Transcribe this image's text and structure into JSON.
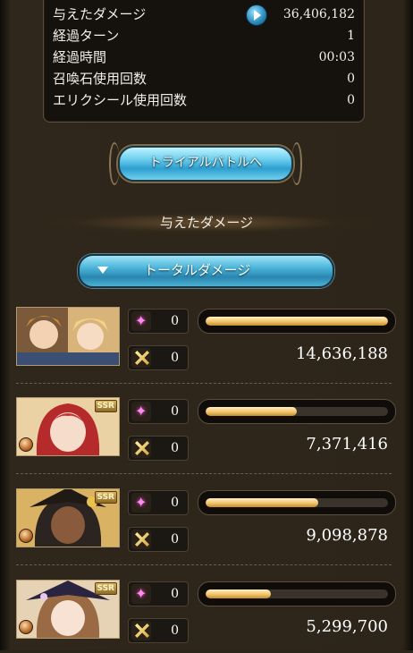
{
  "stats": {
    "rows": [
      {
        "label": "与えたダメージ",
        "value": "36,406,182"
      },
      {
        "label": "経過ターン",
        "value": "1"
      },
      {
        "label": "経過時間",
        "value": "00:03"
      },
      {
        "label": "召喚石使用回数",
        "value": "0"
      },
      {
        "label": "エリクシール使用回数",
        "value": "0"
      }
    ]
  },
  "trial_button_label": "トライアルバトルへ",
  "section_title": "与えたダメージ",
  "dropdown": {
    "selected": "トータルダメージ",
    "icon": "caret-down-icon"
  },
  "characters": [
    {
      "portrait": "duo-hero-portrait",
      "rarity": "",
      "ougi_count": "0",
      "skill_count": "0",
      "damage": "14,636,188",
      "damage_ratio": 1.0
    },
    {
      "portrait": "red-hair-character-portrait",
      "rarity": "SSR",
      "ougi_count": "0",
      "skill_count": "0",
      "damage": "7,371,416",
      "damage_ratio": 0.5
    },
    {
      "portrait": "dark-skin-character-portrait",
      "rarity": "SSR",
      "ougi_count": "0",
      "skill_count": "0",
      "damage": "9,098,878",
      "damage_ratio": 0.62
    },
    {
      "portrait": "witch-hat-character-portrait",
      "rarity": "SSR",
      "ougi_count": "0",
      "skill_count": "0",
      "damage": "5,299,700",
      "damage_ratio": 0.36
    }
  ],
  "colors": {
    "accent_blue": "#4ab4d8",
    "bar_gold": "#f1c46b",
    "panel_bg": "#15110d"
  }
}
